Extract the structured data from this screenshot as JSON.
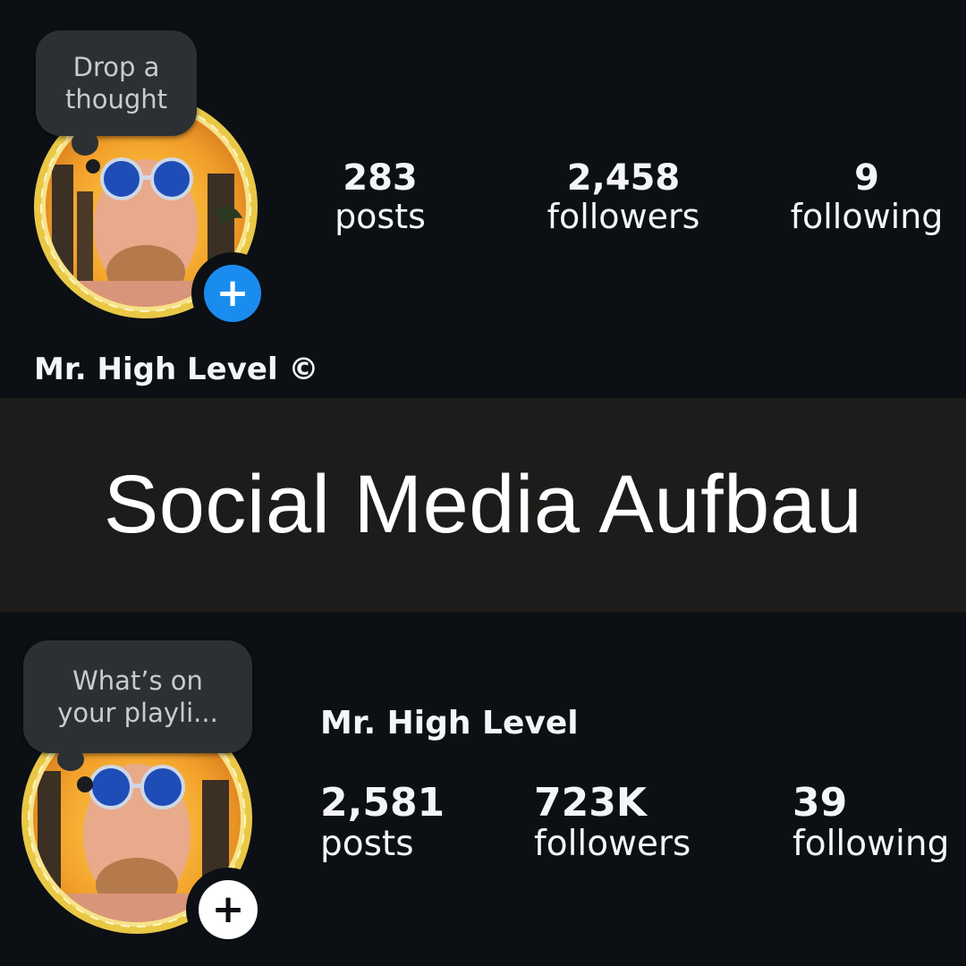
{
  "top_profile": {
    "note_bubble_lines": [
      "Drop a",
      "thought"
    ],
    "stats": [
      {
        "value": "283",
        "label": "posts"
      },
      {
        "value": "2,458",
        "label": "followers"
      },
      {
        "value": "9",
        "label": "following"
      }
    ],
    "name": "Mr. High Level ©",
    "add_story_badge": "+"
  },
  "banner": {
    "title": "Social Media Aufbau"
  },
  "bottom_profile": {
    "note_bubble_lines": [
      "What’s on",
      "your playli..."
    ],
    "name": "Mr. High Level",
    "stats": [
      {
        "value": "2,581",
        "label": "posts"
      },
      {
        "value": "723K",
        "label": "followers"
      },
      {
        "value": "39",
        "label": "following"
      }
    ],
    "add_story_badge": "+"
  },
  "colors": {
    "background": "#0c0f14",
    "banner_bg": "#1d1c1a",
    "badge_blue": "#1a8cf0",
    "badge_white": "#ffffff",
    "ring_gold": "#e8c43a"
  }
}
